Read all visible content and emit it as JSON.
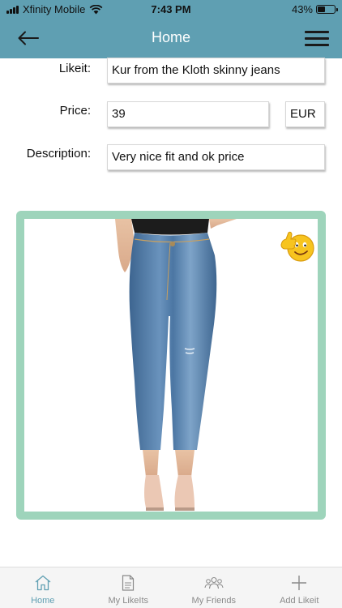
{
  "status_bar": {
    "carrier": "Xfinity Mobile",
    "time": "7:43 PM",
    "battery_percent": "43%",
    "battery_level": 0.43
  },
  "nav": {
    "title": "Home",
    "back_icon": "arrow-left-icon",
    "menu_icon": "hamburger-menu-icon"
  },
  "form": {
    "likeit_label": "Likeit:",
    "likeit_value": "Kur from the Kloth skinny jeans",
    "price_label": "Price:",
    "price_value": "39",
    "currency": "EUR",
    "description_label": "Description:",
    "description_value": "Very nice fit and ok price"
  },
  "card": {
    "image": "skinny-jeans-photo",
    "badge_icon": "thumbs-up-emoji-icon",
    "border_color": "#9ed4bb"
  },
  "tabs": [
    {
      "label": "Home",
      "icon": "home-icon",
      "active": true
    },
    {
      "label": "My LikeIts",
      "icon": "document-icon",
      "active": false
    },
    {
      "label": "My Friends",
      "icon": "friends-icon",
      "active": false
    },
    {
      "label": "Add Likeit",
      "icon": "plus-icon",
      "active": false
    }
  ],
  "colors": {
    "header": "#5f9fb2",
    "active_tab": "#5f9fb2",
    "inactive_tab": "#8a8a8a"
  }
}
